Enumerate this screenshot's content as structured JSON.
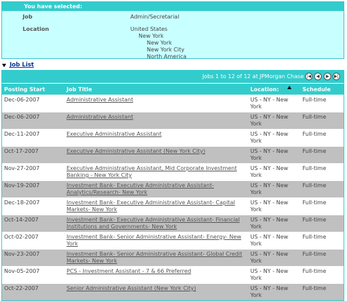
{
  "selection": {
    "header": "You have selected:",
    "job_label": "Job",
    "job_value": "Admin/Secretarial",
    "location_label": "Location",
    "locations": [
      "United States",
      "New York",
      "New York",
      "New York City",
      "North America"
    ]
  },
  "job_list_label": "Job List",
  "pagination": {
    "text": "Jobs 1 to 12 of 12 at JPMorgan Chase"
  },
  "columns": [
    "Posting Start",
    "Job Title",
    "Location:",
    "Schedule"
  ],
  "rows": [
    {
      "date": "Dec-06-2007",
      "title": "Administrative Assistant",
      "location": "US - NY - New York",
      "schedule": "Full-time"
    },
    {
      "date": "Dec-06-2007",
      "title": "Administrative Assistant",
      "location": "US - NY - New York",
      "schedule": "Full-time"
    },
    {
      "date": "Dec-11-2007",
      "title": "Executive Administrative Assistant",
      "location": "US - NY - New York",
      "schedule": "Full-time"
    },
    {
      "date": "Oct-17-2007",
      "title": "Executive Administrative Assistant (New York City)",
      "location": "US - NY - New York",
      "schedule": "Full-time"
    },
    {
      "date": "Nov-27-2007",
      "title": "Executive Administrative Assistant, Mid Corporate Investment Banking - New York City",
      "location": "US - NY - New York",
      "schedule": "Full-time"
    },
    {
      "date": "Nov-19-2007",
      "title": "Investment Bank- Executive Administrative Assistant- Analytics/Research- New York",
      "location": "US - NY - New York",
      "schedule": "Full-time"
    },
    {
      "date": "Dec-18-2007",
      "title": "Investment Bank- Executive Administrative Assistant- Capital Markets- New York",
      "location": "US - NY - New York",
      "schedule": "Full-time"
    },
    {
      "date": "Oct-14-2007",
      "title": "Investment Bank- Executive Administrative Assistant- Financial Institutions and Governments- New York",
      "location": "US - NY - New York",
      "schedule": "Full-time"
    },
    {
      "date": "Oct-02-2007",
      "title": "Investment Bank- Senior Administrative Assistant- Energy- New York",
      "location": "US - NY - New York",
      "schedule": "Full-time"
    },
    {
      "date": "Nov-23-2007",
      "title": "Investment Bank- Senior Administrative Assistant- Global Credit Markets- New York",
      "location": "US - NY - New York",
      "schedule": "Full-time"
    },
    {
      "date": "Nov-05-2007",
      "title": "PCS - Investment Assistant - 7 & 66 Preferred",
      "location": "US - NY - New York",
      "schedule": "Full-time"
    },
    {
      "date": "Oct-22-2007",
      "title": "Senior Administrative Assistant (New York City)",
      "location": "US - NY - New York",
      "schedule": "Full-time"
    }
  ],
  "nav_icons": [
    "first-page-icon",
    "prev-page-icon",
    "next-page-icon",
    "last-page-icon"
  ],
  "colors": {
    "accent": "#33cccc",
    "panel": "#c8ffff",
    "alt_row": "#c0c0c0",
    "link": "#003399"
  }
}
